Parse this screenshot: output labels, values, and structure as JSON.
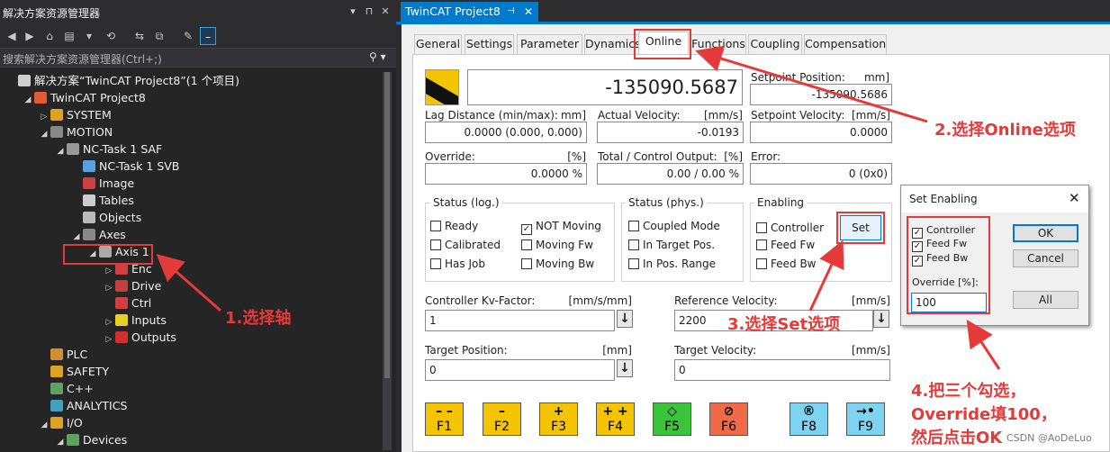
{
  "explorer": {
    "title": "解决方案资源管理器",
    "title_buttons": [
      "▾",
      "⊓",
      "✕"
    ],
    "search_placeholder": "搜索解决方案资源管理器(Ctrl+;)",
    "search_icon": "search-icon",
    "toolbar_icons": [
      "back-icon",
      "forward-icon",
      "home-icon",
      "solution-switch-icon",
      "history-icon",
      "sync-icon",
      "collapse-icon",
      "wrench-icon",
      "minus-icon"
    ],
    "tree": [
      {
        "label": "解决方案“TwinCAT Project8”(1 个项目)",
        "icon": "solution-icon",
        "color": "#cfcfcf",
        "level": 0,
        "expander": ""
      },
      {
        "label": "TwinCAT Project8",
        "icon": "twincat-project-icon",
        "color": "#e55934",
        "level": 1,
        "expander": "◢"
      },
      {
        "label": "SYSTEM",
        "icon": "system-icon",
        "color": "#e0a020",
        "level": 2,
        "expander": "▷"
      },
      {
        "label": "MOTION",
        "icon": "motion-icon",
        "color": "#888888",
        "level": 2,
        "expander": "◢"
      },
      {
        "label": "NC-Task 1 SAF",
        "icon": "task-icon",
        "color": "#999999",
        "level": 3,
        "expander": "◢"
      },
      {
        "label": "NC-Task 1 SVB",
        "icon": "task-svb-icon",
        "color": "#5aa0e0",
        "level": 4,
        "expander": ""
      },
      {
        "label": "Image",
        "icon": "image-icon",
        "color": "#d04040",
        "level": 4,
        "expander": ""
      },
      {
        "label": "Tables",
        "icon": "tables-icon",
        "color": "#cccccc",
        "level": 4,
        "expander": ""
      },
      {
        "label": "Objects",
        "icon": "objects-icon",
        "color": "#bbbbbb",
        "level": 4,
        "expander": ""
      },
      {
        "label": "Axes",
        "icon": "axes-icon",
        "color": "#888888",
        "level": 4,
        "expander": "◢"
      },
      {
        "label": "Axis 1",
        "icon": "axis-icon",
        "color": "#aaaaaa",
        "level": 5,
        "expander": "◢"
      },
      {
        "label": "Enc",
        "icon": "encoder-icon",
        "color": "#d04040",
        "level": 6,
        "expander": "▷"
      },
      {
        "label": "Drive",
        "icon": "drive-icon",
        "color": "#c04040",
        "level": 6,
        "expander": "▷"
      },
      {
        "label": "Ctrl",
        "icon": "ctrl-icon",
        "color": "#d04040",
        "level": 6,
        "expander": ""
      },
      {
        "label": "Inputs",
        "icon": "inputs-icon",
        "color": "#e8d020",
        "level": 6,
        "expander": "▷"
      },
      {
        "label": "Outputs",
        "icon": "outputs-icon",
        "color": "#d03030",
        "level": 6,
        "expander": "▷"
      },
      {
        "label": "PLC",
        "icon": "plc-icon",
        "color": "#d09030",
        "level": 2,
        "expander": ""
      },
      {
        "label": "SAFETY",
        "icon": "safety-icon",
        "color": "#e0a020",
        "level": 2,
        "expander": ""
      },
      {
        "label": "C++",
        "icon": "cpp-icon",
        "color": "#60a060",
        "level": 2,
        "expander": ""
      },
      {
        "label": "ANALYTICS",
        "icon": "analytics-icon",
        "color": "#40a0c0",
        "level": 2,
        "expander": ""
      },
      {
        "label": "I/O",
        "icon": "io-icon",
        "color": "#e0a020",
        "level": 2,
        "expander": "◢"
      },
      {
        "label": "Devices",
        "icon": "devices-icon",
        "color": "#60a060",
        "level": 3,
        "expander": "◢"
      }
    ]
  },
  "doc": {
    "tab_title": "TwinCAT Project8",
    "tab_pin": "⊣",
    "tab_close": "✕",
    "tabs": [
      "General",
      "Settings",
      "Parameter",
      "Dynamics",
      "Online",
      "Functions",
      "Coupling",
      "Compensation"
    ],
    "selected_tab": "Online"
  },
  "online": {
    "position_value": "-135090.5687",
    "setpoint_position": {
      "label": "Setpoint Position:",
      "unit": "mm]",
      "value": "-135090.5686"
    },
    "lag_distance": {
      "label": "Lag Distance (min/max):",
      "unit": "mm]",
      "value": "0.0000  (0.000, 0.000)"
    },
    "actual_velocity": {
      "label": "Actual Velocity:",
      "unit": "[mm/s]",
      "value": "-0.0193"
    },
    "setpoint_velocity": {
      "label": "Setpoint Velocity:",
      "unit": "[mm/s]",
      "value": "0.0000"
    },
    "override": {
      "label": "Override:",
      "unit": "[%]",
      "value": "0.0000 %"
    },
    "total_output": {
      "label": "Total / Control Output:",
      "unit": "[%]",
      "value": "0.00 /  0.00 %"
    },
    "error": {
      "label": "Error:",
      "value": "0 (0x0)"
    },
    "status_log": {
      "title": "Status (log.)",
      "items": [
        {
          "label": "Ready",
          "checked": false
        },
        {
          "label": "NOT Moving",
          "checked": true
        },
        {
          "label": "Calibrated",
          "checked": false
        },
        {
          "label": "Moving Fw",
          "checked": false
        },
        {
          "label": "Has Job",
          "checked": false
        },
        {
          "label": "Moving Bw",
          "checked": false
        }
      ]
    },
    "status_phys": {
      "title": "Status (phys.)",
      "items": [
        {
          "label": "Coupled Mode",
          "checked": false
        },
        {
          "label": "In Target Pos.",
          "checked": false
        },
        {
          "label": "In Pos. Range",
          "checked": false
        }
      ]
    },
    "enabling": {
      "title": "Enabling",
      "items": [
        {
          "label": "Controller",
          "checked": false
        },
        {
          "label": "Feed Fw",
          "checked": false
        },
        {
          "label": "Feed Bw",
          "checked": false
        }
      ],
      "set_button": "Set"
    },
    "kv_factor": {
      "label": "Controller Kv-Factor:",
      "unit": "[mm/s/mm]",
      "value": "1"
    },
    "ref_velocity": {
      "label": "Reference Velocity:",
      "unit": "[mm/s]",
      "value": "2200"
    },
    "target_position": {
      "label": "Target Position:",
      "unit": "[mm]",
      "value": "0"
    },
    "target_velocity": {
      "label": "Target Velocity:",
      "unit": "[mm/s]",
      "value": "0"
    },
    "apply_glyph": "↓",
    "function_buttons": [
      {
        "label": "F1",
        "symbol": "– –",
        "color": "#f5c400"
      },
      {
        "label": "F2",
        "symbol": "–",
        "color": "#f5c400"
      },
      {
        "label": "F3",
        "symbol": "+",
        "color": "#f5c400"
      },
      {
        "label": "F4",
        "symbol": "+ +",
        "color": "#f5c400"
      },
      {
        "label": "F5",
        "symbol": "◇",
        "color": "#3cc33c"
      },
      {
        "label": "F6",
        "symbol": "⊘",
        "color": "#f06a4a"
      },
      {
        "label": "F8",
        "symbol": "®",
        "color": "#7ed3f0"
      },
      {
        "label": "F9",
        "symbol": "→•",
        "color": "#7ed3f0"
      }
    ]
  },
  "dialog": {
    "title": "Set Enabling",
    "close": "✕",
    "checks": [
      {
        "label": "Controller",
        "checked": true
      },
      {
        "label": "Feed Fw",
        "checked": true
      },
      {
        "label": "Feed Bw",
        "checked": true
      }
    ],
    "override_label": "Override [%]:",
    "override_value": "100",
    "ok": "OK",
    "cancel": "Cancel",
    "all": "All"
  },
  "annotations": {
    "step1": "1.选择轴",
    "step2": "2.选择Online选项",
    "step3": "3.选择Set选项",
    "step4_line1": "4.把三个勾选，",
    "step4_line2": "Override填100，",
    "step4_line3": "然后点击OK"
  },
  "watermark": "CSDN @AoDeLuo",
  "colors": {
    "annotation_red": "#e43a3a",
    "accent_blue": "#007acc"
  }
}
